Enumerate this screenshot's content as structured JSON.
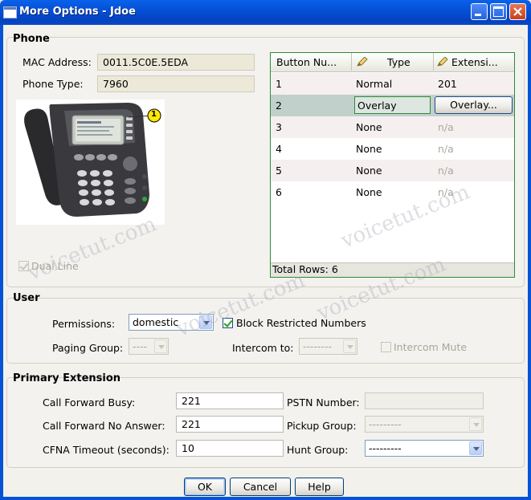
{
  "window": {
    "title": "More Options - Jdoe"
  },
  "phone": {
    "section_title": "Phone",
    "mac_label": "MAC Address:",
    "mac_value": "0011.5C0E.5EDA",
    "type_label": "Phone Type:",
    "type_value": "7960",
    "callout": "1",
    "dual_line_label": "Dual Line",
    "dual_line_checked": true
  },
  "buttons_table": {
    "columns": [
      "Button Nu...",
      "Type",
      "Extensi..."
    ],
    "rows": [
      {
        "num": "1",
        "type": "Normal",
        "ext": "201"
      },
      {
        "num": "2",
        "type": "Overlay",
        "ext": "Overlay..."
      },
      {
        "num": "3",
        "type": "None",
        "ext": "n/a"
      },
      {
        "num": "4",
        "type": "None",
        "ext": "n/a"
      },
      {
        "num": "5",
        "type": "None",
        "ext": "n/a"
      },
      {
        "num": "6",
        "type": "None",
        "ext": "n/a"
      }
    ],
    "footer": "Total Rows: 6"
  },
  "user": {
    "section_title": "User",
    "permissions_label": "Permissions:",
    "permissions_value": "domestic",
    "block_restricted_label": "Block Restricted Numbers",
    "block_restricted_checked": true,
    "paging_label": "Paging Group:",
    "paging_value": "----",
    "intercom_label": "Intercom to:",
    "intercom_value": "--------",
    "intercom_mute_label": "Intercom Mute",
    "intercom_mute_checked": false
  },
  "primary_extension": {
    "section_title": "Primary Extension",
    "cfb_label": "Call Forward Busy:",
    "cfb_value": "221",
    "cfna_label": "Call Forward No Answer:",
    "cfna_value": "221",
    "cfna_timeout_label": "CFNA Timeout (seconds):",
    "cfna_timeout_value": "10",
    "pstn_label": "PSTN Number:",
    "pstn_value": "",
    "pickup_label": "Pickup Group:",
    "pickup_value": "---------",
    "hunt_label": "Hunt Group:",
    "hunt_value": "---------"
  },
  "dialog_buttons": {
    "ok": "OK",
    "cancel": "Cancel",
    "help": "Help"
  },
  "watermark": "voicetut.com",
  "colors": {
    "titlebar": "#0550d6",
    "table_border": "#2d8b3a",
    "selected_row": "#c2d0cc"
  }
}
